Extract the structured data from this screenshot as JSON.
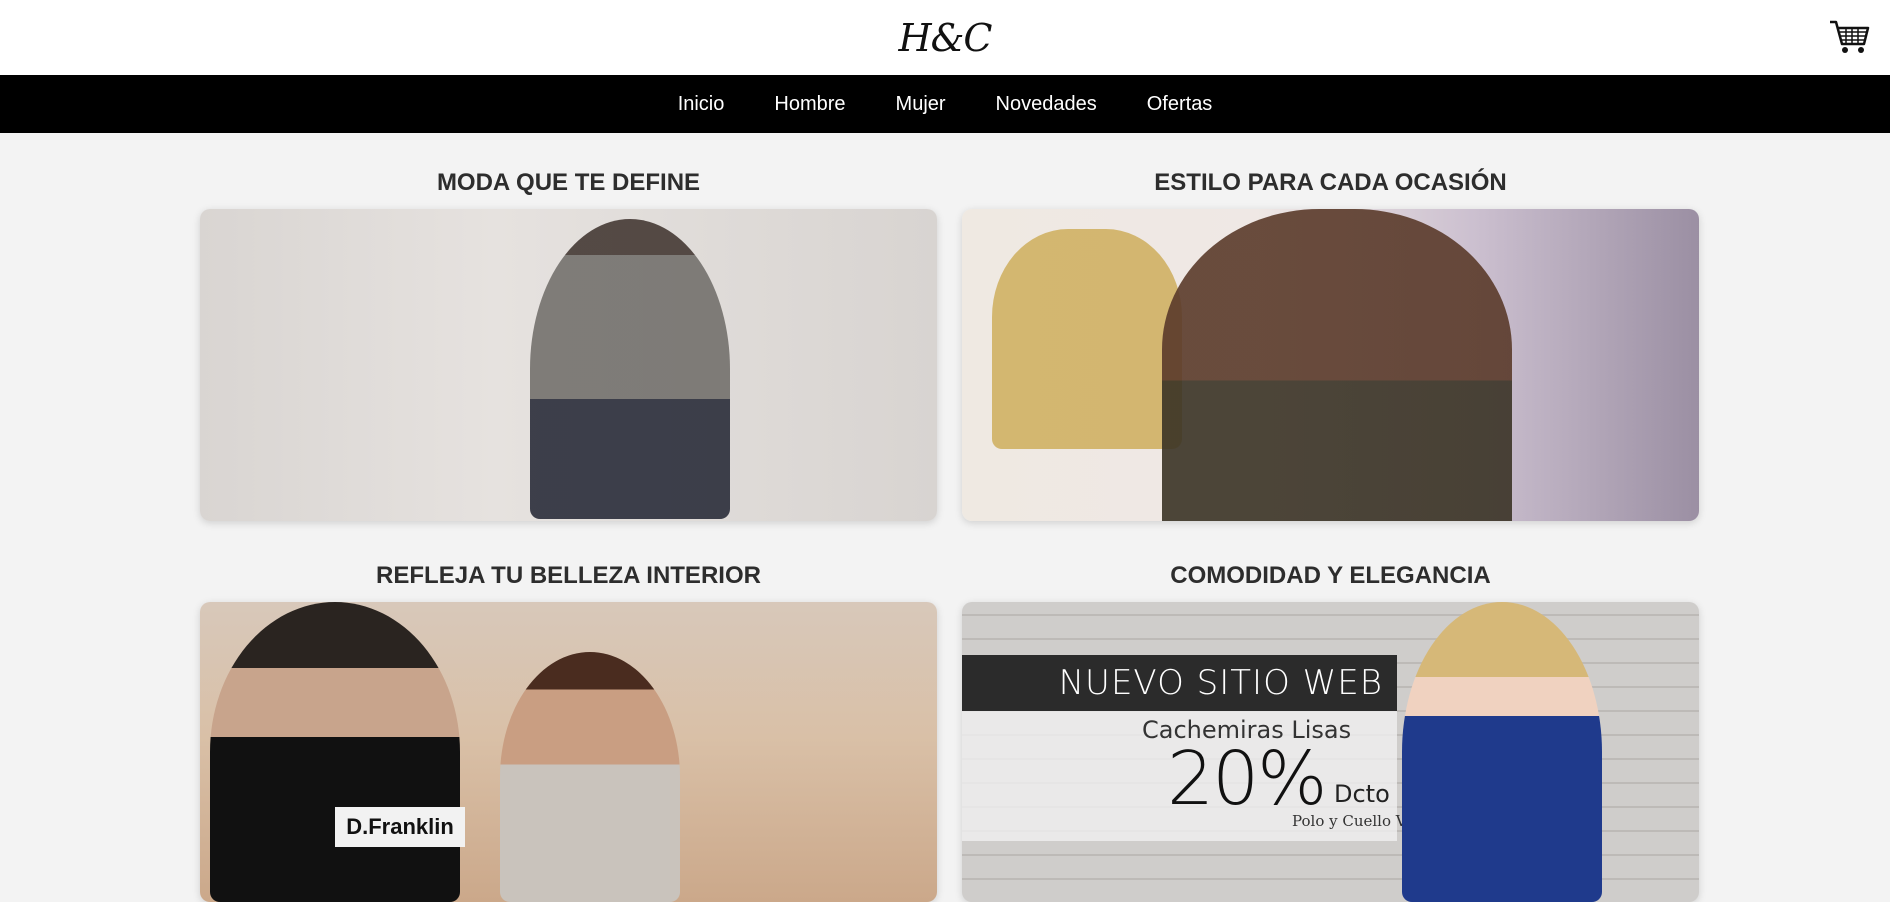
{
  "header": {
    "logo": "H&C",
    "cart_icon": "shopping-cart-icon"
  },
  "nav": {
    "items": [
      "Inicio",
      "Hombre",
      "Mujer",
      "Novedades",
      "Ofertas"
    ]
  },
  "cards": [
    {
      "title": "MODA QUE TE DEFINE"
    },
    {
      "title": "ESTILO PARA CADA OCASIÓN"
    },
    {
      "title": "REFLEJA TU BELLEZA INTERIOR",
      "brand_text": "D.Franklin"
    },
    {
      "title": "COMODIDAD Y ELEGANCIA",
      "promo": {
        "headline": "NUEVO SITIO WEB",
        "subtitle": "Cachemiras Lisas",
        "percent": "20%",
        "discount_label": "Dcto",
        "small": "Polo y Cuello V"
      }
    }
  ],
  "colors": {
    "nav_bg": "#000000",
    "page_bg": "#f3f3f3",
    "title_color": "#2d2d2d"
  }
}
